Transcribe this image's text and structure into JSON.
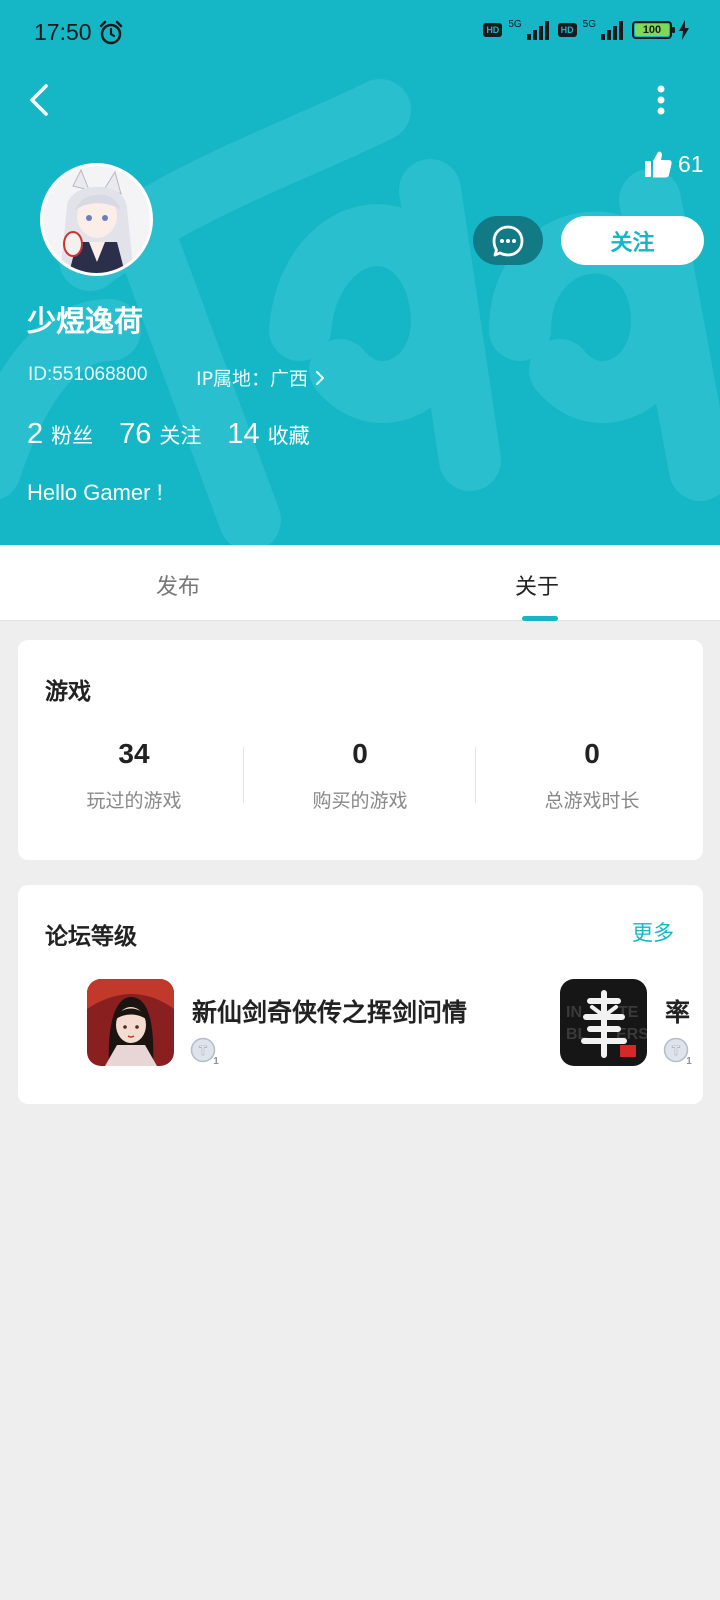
{
  "status_bar": {
    "time": "17:50",
    "network_1": "5G",
    "network_2": "5G",
    "battery": "100",
    "battery_level": 1.0,
    "icons": [
      "alarm-icon",
      "hd-icon",
      "signal-icon",
      "hd-icon",
      "signal-icon",
      "battery-icon",
      "charging-icon"
    ]
  },
  "header": {
    "background_color": "#15b6c6",
    "likes_count": "61",
    "follow_label": "关注",
    "username": "少煜逸荷",
    "user_id": "ID:551068800",
    "ip_location": "IP属地：广西",
    "stats": [
      {
        "value": "2",
        "label": "粉丝"
      },
      {
        "value": "76",
        "label": "关注"
      },
      {
        "value": "14",
        "label": "收藏"
      }
    ],
    "bio": "Hello Gamer !"
  },
  "tabs": [
    {
      "label": "发布",
      "active": false
    },
    {
      "label": "关于",
      "active": true
    }
  ],
  "games_card": {
    "title": "游戏",
    "stats": [
      {
        "value": "34",
        "label": "玩过的游戏"
      },
      {
        "value": "0",
        "label": "购买的游戏"
      },
      {
        "value": "0",
        "label": "总游戏时长"
      }
    ]
  },
  "forum_card": {
    "title": "论坛等级",
    "more_label": "更多",
    "items": [
      {
        "name": "新仙剑奇侠传之挥剑问情",
        "level": "1"
      },
      {
        "name": "率",
        "level": "1"
      }
    ]
  },
  "accent_color": "#15b6c6"
}
